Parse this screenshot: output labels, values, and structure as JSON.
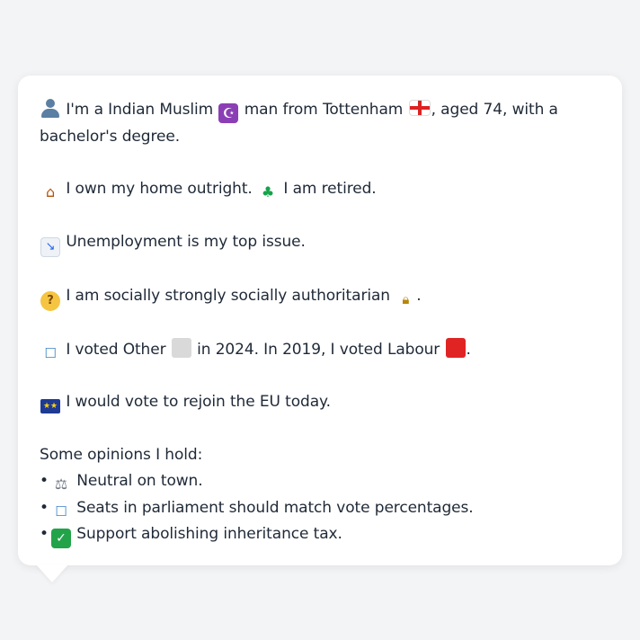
{
  "bubble": {
    "intro": {
      "icon": "person-silhouette-icon",
      "part1": "I'm a Indian Muslim",
      "religion_icon": "star-and-crescent-icon",
      "part2": "man from Tottenham",
      "flag_icon": "england-flag-icon",
      "part3": ", aged 74, with a",
      "part4": "bachelor's degree."
    },
    "housing": {
      "home_icon": "house-icon",
      "home_text": "I own my home outright.",
      "work_icon": "palm-tree-icon",
      "work_text": "I am retired."
    },
    "issue": {
      "icon": "chart-decreasing-icon",
      "text": "Unemployment is my top issue."
    },
    "social": {
      "icon": "thinking-face-icon",
      "text": "I am socially strongly socially authoritarian",
      "lock_icon": "lock-icon",
      "end": "."
    },
    "vote": {
      "icon": "ballot-box-icon",
      "part1": "I voted Other",
      "other_swatch_icon": "grey-square-icon",
      "part2": "in 2024. In 2019, I voted Labour",
      "labour_swatch_icon": "red-square-icon",
      "end": "."
    },
    "eu": {
      "icon": "eu-flag-icon",
      "text": "I would vote to rejoin the EU today."
    },
    "opinions": {
      "heading": "Some opinions I hold:",
      "bullet": "•",
      "items": [
        {
          "icon": "balance-scale-icon",
          "text": "Neutral on town."
        },
        {
          "icon": "ballot-box-icon",
          "text": "Seats in parliament should match vote percentages."
        },
        {
          "icon": "check-mark-button-icon",
          "text": "Support abolishing inheritance tax."
        }
      ]
    }
  },
  "colors": {
    "background": "#f3f4f6",
    "card": "#ffffff",
    "text": "#1f2937",
    "labour_red": "#e02424",
    "other_grey": "#d9d9d9"
  }
}
